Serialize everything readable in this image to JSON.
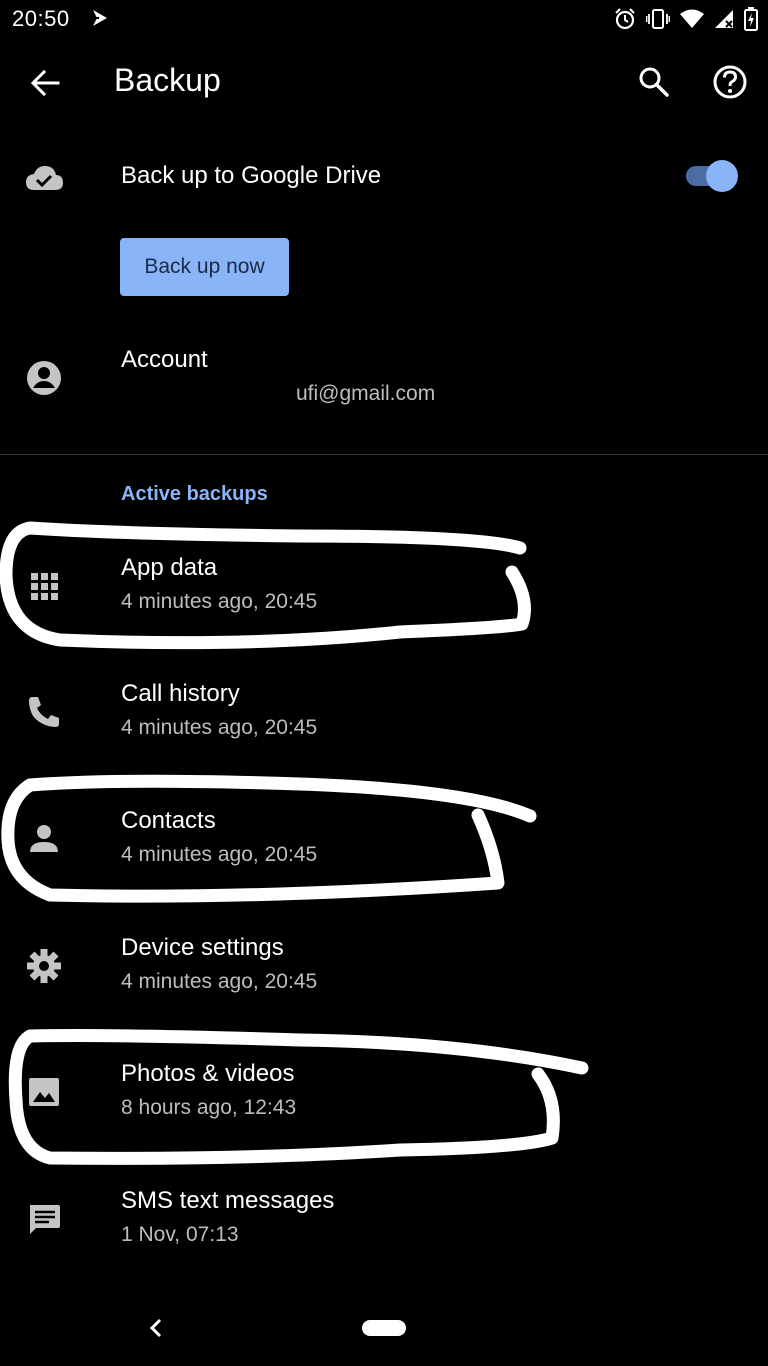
{
  "status_bar": {
    "time": "20:50"
  },
  "app_bar": {
    "title": "Backup"
  },
  "backup": {
    "drive_label": "Back up to Google Drive",
    "drive_enabled": true,
    "button_label": "Back up now",
    "account_label": "Account",
    "account_email": "ufi@gmail.com"
  },
  "active_backups": {
    "header": "Active backups",
    "items": [
      {
        "title": "App data",
        "subtitle": "4 minutes ago, 20:45",
        "icon": "apps-grid-icon"
      },
      {
        "title": "Call history",
        "subtitle": "4 minutes ago, 20:45",
        "icon": "phone-icon"
      },
      {
        "title": "Contacts",
        "subtitle": "4 minutes ago, 20:45",
        "icon": "person-icon"
      },
      {
        "title": "Device settings",
        "subtitle": "4 minutes ago, 20:45",
        "icon": "gear-icon"
      },
      {
        "title": "Photos & videos",
        "subtitle": "8 hours ago, 12:43",
        "icon": "image-icon"
      },
      {
        "title": "SMS text messages",
        "subtitle": "1 Nov, 07:13",
        "icon": "message-icon"
      }
    ]
  },
  "colors": {
    "background": "#000000",
    "accent": "#8ab4f8",
    "subtitle_text": "#bdbdbd",
    "icon": "#c4c4c4"
  }
}
